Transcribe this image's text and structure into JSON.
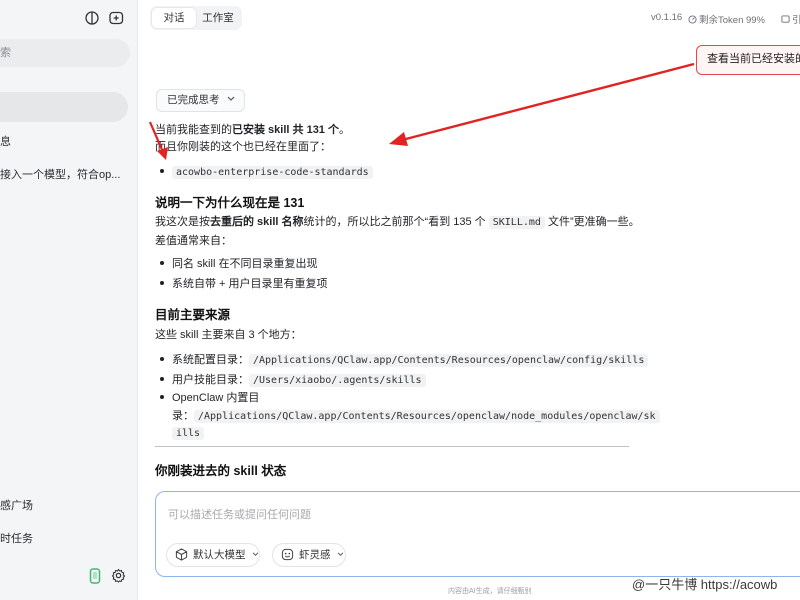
{
  "sidebar": {
    "search_placeholder": "索",
    "items": [
      {
        "label": "息"
      },
      {
        "label": "接入一个模型，符合op..."
      },
      {
        "label": "感广场"
      },
      {
        "label": "时任务"
      }
    ]
  },
  "header": {
    "tabs": [
      {
        "label": "对话",
        "active": true
      },
      {
        "label": "工作室",
        "active": false
      }
    ],
    "version": "v0.1.16",
    "token_text": "剩余Token 99%",
    "right_label": "引"
  },
  "user_message": "查看当前已经安装的",
  "thinking_chip": "已完成思考",
  "content": {
    "intro_pre": "当前我能查到的",
    "intro_bold": "已安装 skill 共 131 个",
    "intro_post": "。",
    "intro2": "而且你刚装的这个也已经在里面了：",
    "installed_skill": "acowbo-enterprise-code-standards",
    "h1": "说明一下为什么现在是 131",
    "p1_pre": "我这次是按",
    "p1_bold": "去重后的 skill 名称",
    "p1_mid": "统计的，所以比之前那个“看到 135 个",
    "p1_code": "SKILL.md",
    "p1_post": "文件”更准确一些。",
    "p2": "差值通常来自：",
    "reasons": [
      "同名 skill 在不同目录重复出现",
      "系统自带 + 用户目录里有重复项"
    ],
    "h2": "目前主要来源",
    "p3": "这些 skill 主要来自 3 个地方：",
    "src1_label": "系统配置目录：",
    "src1_path": "/Applications/QClaw.app/Contents/Resources/openclaw/config/skills",
    "src2_label": "用户技能目录：",
    "src2_path": "/Users/xiaobo/.agents/skills",
    "src3_label_a": "OpenClaw 内置目",
    "src3_label_b": "录：",
    "src3_path_a": "/Applications/QClaw.app/Contents/Resources/openclaw/node_modules/openclaw/sk",
    "src3_path_b": "ills",
    "h3": "你刚装进去的 skill 状态"
  },
  "composer": {
    "placeholder": "可以描述任务或提问任何问题",
    "model_label": "默认大模型",
    "skill_label": "虾灵感"
  },
  "footnote": "内容由AI生成，请仔细甄别",
  "watermark": "@一只牛博  https://acowb",
  "colors": {
    "annotation_red": "#e02424",
    "composer_border": "#8fb5ee",
    "sidebar_bg": "#f4f5f6"
  }
}
